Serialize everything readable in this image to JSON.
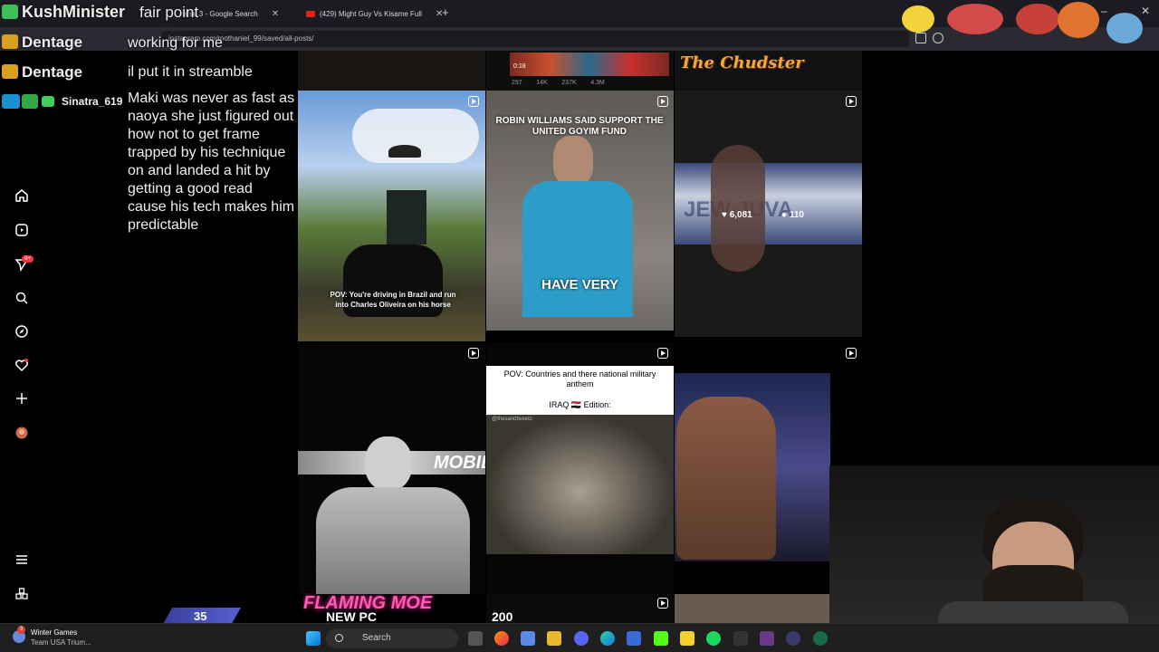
{
  "browser": {
    "tabs": [
      {
        "label": "erse 3 - Google Search"
      },
      {
        "label": "(429) Might Guy Vs Kisame Full"
      }
    ],
    "url": "instagram.com/mothaniel_99/saved/all-posts/",
    "new_tab": "+",
    "close": "✕",
    "minimize": "–"
  },
  "chat": {
    "messages": [
      {
        "user": "KushMinister",
        "text": "fair point"
      },
      {
        "user": "Dentage",
        "text": "working for me"
      },
      {
        "user": "Dentage",
        "text": "il put it in streamble"
      },
      {
        "user": "Sinatra_619",
        "text": "Maki was never as fast as naoya she just figured out how not to get frame trapped by his technique on and landed a hit by getting a good read cause his tech makes him predictable"
      }
    ]
  },
  "sidebar": {
    "icons": [
      "home-icon",
      "reels-icon",
      "messages-icon",
      "search-icon",
      "explore-icon",
      "notifications-icon",
      "create-icon",
      "profile-icon",
      "menu-icon",
      "more-icon"
    ],
    "notification_badge": "9+"
  },
  "posts": {
    "top_strip": {
      "stats": [
        "297",
        "14K",
        "237K",
        "4.3M"
      ],
      "time": "0:18",
      "logo": "The Chudster"
    },
    "cowboy": {
      "caption": "POV: You're driving in Brazil and run into Charles Oliveira on his horse"
    },
    "robin": {
      "top_caption": "ROBIN WILLIAMS SAID SUPPORT THE UNITED GOYIM FUND",
      "bottom_caption": "HAVE VERY"
    },
    "wrestler": {
      "likes": "6,081",
      "comments": "110",
      "banner_text": "JEW JUVA"
    },
    "fighter": {
      "banner_text": "MOBIL"
    },
    "iraq": {
      "caption": "POV: Countries and there national military anthem",
      "edition": "IRAQ 🇮🇶 Edition:",
      "watermark": "@thesandtweets"
    }
  },
  "overlay": {
    "counter": "35",
    "new_pc": "NEW PC",
    "count_200": "200",
    "flaming": "FLAMING MOE"
  },
  "taskbar": {
    "weather_title": "Winter Games",
    "weather_sub": "Team USA Trium...",
    "search_placeholder": "Search",
    "notification_count": "3"
  }
}
